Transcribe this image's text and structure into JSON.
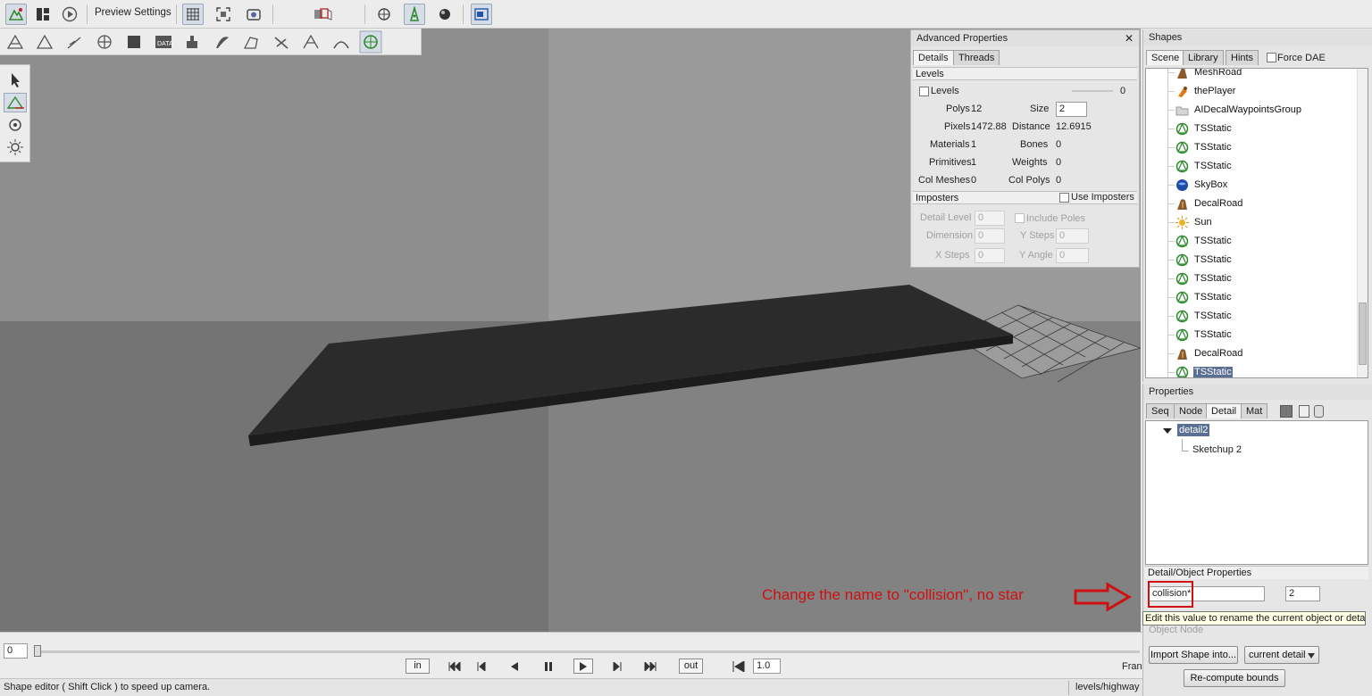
{
  "toolbar": {
    "preview_settings": "Preview Settings",
    "icons": [
      "world-editor-icon",
      "gui-editor-icon",
      "play-icon",
      "grid-icon",
      "fit-view-icon",
      "camera-icon",
      "object-view-icon",
      "select-icon",
      "move-icon",
      "sun-icon",
      "snap-icon",
      "window-icon"
    ]
  },
  "advanced": {
    "title": "Advanced Properties",
    "close": "✕",
    "tabs": [
      "Details",
      "Threads"
    ],
    "levels_header": "Levels",
    "levels_label": "Levels",
    "levels_value": "0",
    "polys_label": "Polys",
    "polys_value": "12",
    "size_label": "Size",
    "size_value": "2",
    "pixels_label": "Pixels",
    "pixels_value": "1472.88",
    "distance_label": "Distance",
    "distance_value": "12.6915",
    "materials_label": "Materials",
    "materials_value": "1",
    "bones_label": "Bones",
    "bones_value": "0",
    "primitives_label": "Primitives",
    "primitives_value": "1",
    "weights_label": "Weights",
    "weights_value": "0",
    "colmeshes_label": "Col Meshes",
    "colmeshes_value": "0",
    "colpolys_label": "Col Polys",
    "colpolys_value": "0",
    "imposters_header": "Imposters",
    "use_imposters": "Use Imposters",
    "detail_level_label": "Detail Level",
    "detail_level_value": "0",
    "include_poles": "Include Poles",
    "dimension_label": "Dimension",
    "dimension_value": "0",
    "ysteps_label": "Y Steps",
    "ysteps_value": "0",
    "xsteps_label": "X Steps",
    "xsteps_value": "0",
    "yangle_label": "Y Angle",
    "yangle_value": "0"
  },
  "shapes": {
    "title": "Shapes",
    "tabs": [
      "Scene",
      "Library",
      "Hints"
    ],
    "force_dae": "Force DAE",
    "items": [
      {
        "name": "MeshRoad",
        "icon": "mesh-road-icon"
      },
      {
        "name": "thePlayer",
        "icon": "player-icon"
      },
      {
        "name": "AIDecalWaypointsGroup",
        "icon": "folder-icon"
      },
      {
        "name": "TSStatic",
        "icon": "tsstatic-icon"
      },
      {
        "name": "TSStatic",
        "icon": "tsstatic-icon"
      },
      {
        "name": "TSStatic",
        "icon": "tsstatic-icon"
      },
      {
        "name": "SkyBox",
        "icon": "skybox-icon"
      },
      {
        "name": "DecalRoad",
        "icon": "decal-road-icon"
      },
      {
        "name": "Sun",
        "icon": "sun-icon"
      },
      {
        "name": "TSStatic",
        "icon": "tsstatic-icon"
      },
      {
        "name": "TSStatic",
        "icon": "tsstatic-icon"
      },
      {
        "name": "TSStatic",
        "icon": "tsstatic-icon"
      },
      {
        "name": "TSStatic",
        "icon": "tsstatic-icon"
      },
      {
        "name": "TSStatic",
        "icon": "tsstatic-icon"
      },
      {
        "name": "TSStatic",
        "icon": "tsstatic-icon"
      },
      {
        "name": "DecalRoad",
        "icon": "decal-road-icon"
      },
      {
        "name": "TSStatic",
        "icon": "tsstatic-icon",
        "selected": true
      }
    ]
  },
  "properties": {
    "title": "Properties",
    "tabs": [
      "Seq",
      "Node",
      "Detail",
      "Mat"
    ],
    "detail_node": "detail2",
    "sketchup_node": "Sketchup 2",
    "detail_object_header": "Detail/Object Properties",
    "name_value": "collision*",
    "size_value": "2",
    "tooltip": "Edit this value to rename the current object or detail",
    "object_node_label": "Object Node",
    "import_button": "Import Shape into...",
    "current_detail": "current detail",
    "recompute_button": "Re-compute bounds"
  },
  "annotation": {
    "text": "Change the name to \"collision\", no star",
    "color": "#d01010"
  },
  "timeline": {
    "frame_value": "0",
    "in_label": "in",
    "out_label": "out",
    "speed_value": "1.0",
    "frame_label": "Fran"
  },
  "status": {
    "left_text": "Shape editor ( Shift Click ) to speed up camera.",
    "right_text": "levels/highway"
  }
}
